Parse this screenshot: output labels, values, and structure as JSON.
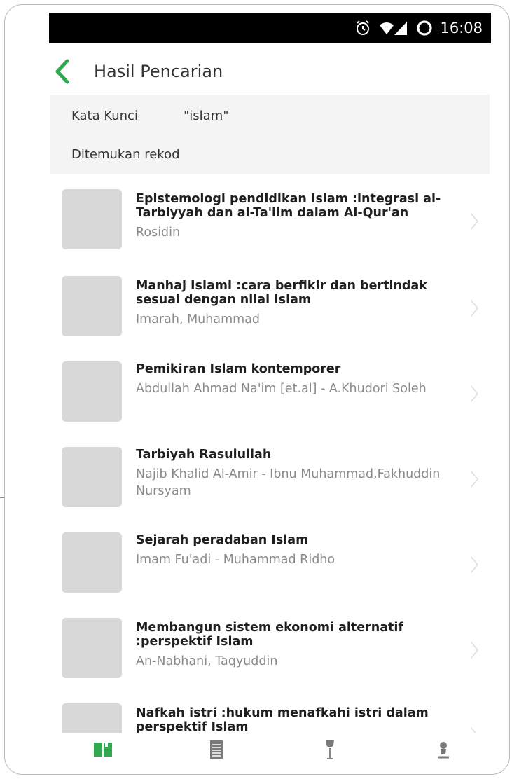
{
  "status": {
    "time": "16:08",
    "icons": [
      "alarm-icon",
      "wifi-icon",
      "signal-icon",
      "battery-icon"
    ]
  },
  "header": {
    "title": "Hasil Pencarian",
    "back_icon": "chevron-left-icon"
  },
  "search": {
    "keyword_label": "Kata Kunci",
    "keyword_value": "\"islam\"",
    "found_label": "Ditemukan rekod"
  },
  "results": [
    {
      "title": "Epistemologi pendidikan Islam :integrasi al-Tarbiyyah dan al-Ta'lim dalam Al-Qur'an",
      "author": "Rosidin"
    },
    {
      "title": "Manhaj Islami :cara berfikir dan bertindak sesuai dengan nilai Islam",
      "author": "Imarah, Muhammad"
    },
    {
      "title": "Pemikiran Islam kontemporer",
      "author": "Abdullah Ahmad Na'im [et.al] - A.Khudori Soleh"
    },
    {
      "title": "Tarbiyah Rasulullah",
      "author": "Najib Khalid Al-Amir - Ibnu Muhammad,Fakhuddin Nursyam"
    },
    {
      "title": "Sejarah peradaban Islam",
      "author": "Imam Fu'adi - Muhammad Ridho"
    },
    {
      "title": "Membangun sistem ekonomi alternatif :perspektif Islam",
      "author": "An-Nabhani, Taqyuddin"
    },
    {
      "title": "Nafkah istri :hukum menafkahi istri dalam perspektif Islam",
      "author": ""
    }
  ],
  "bottom_nav": [
    "book-icon",
    "document-list-icon",
    "wine-glass-icon",
    "person-icon"
  ],
  "colors": {
    "accent": "#2fa84f",
    "thumbnail": "#d8d8d8",
    "info_bg": "#f4f4f4",
    "status_bar": "#000000",
    "muted_text": "#8a8a8a",
    "nav_icon": "#7a7a7a"
  }
}
